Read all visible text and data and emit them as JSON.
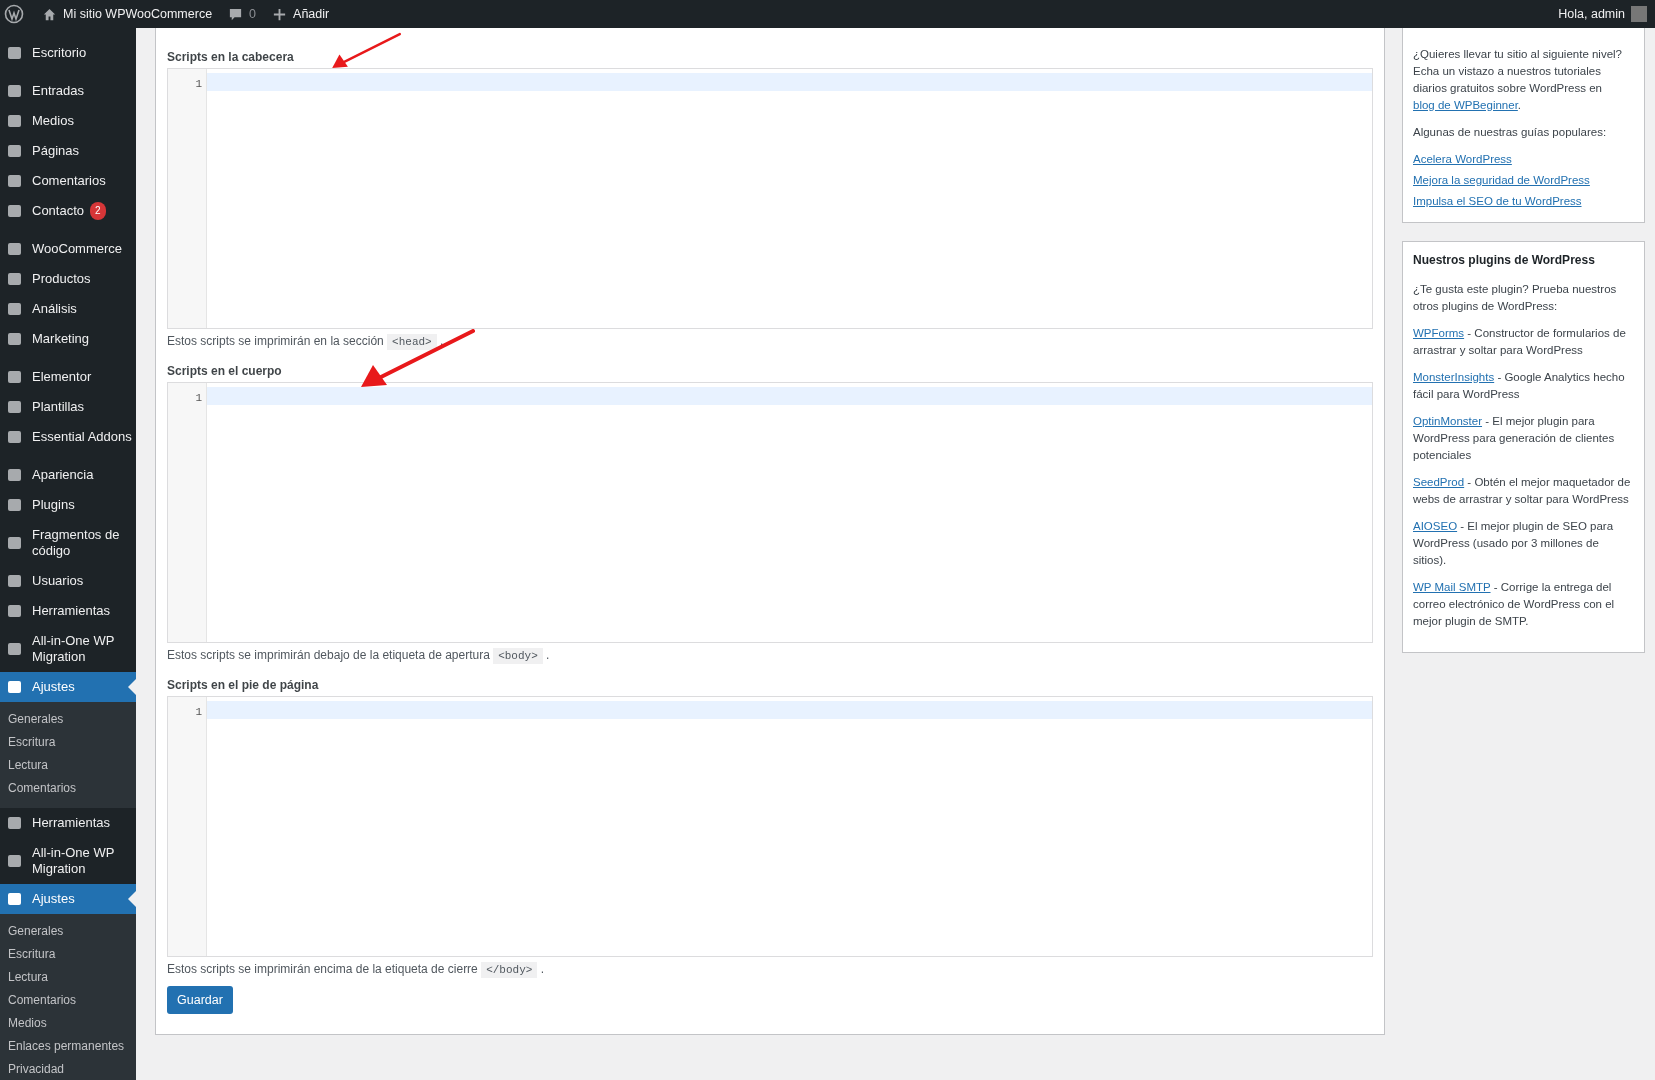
{
  "admin_bar": {
    "site": "Mi sitio WPWooCommerce",
    "comments": "0",
    "new": "Añadir",
    "greeting": "Hola, admin"
  },
  "sidebar": {
    "groups": [
      {
        "items": [
          {
            "label": "Escritorio",
            "selected": false
          }
        ]
      },
      {
        "items": [
          {
            "label": "Entradas",
            "selected": false
          },
          {
            "label": "Medios",
            "selected": false
          },
          {
            "label": "Páginas",
            "selected": false
          },
          {
            "label": "Comentarios",
            "selected": false
          },
          {
            "label": "Contacto",
            "badge": "2",
            "selected": false
          }
        ]
      },
      {
        "items": [
          {
            "label": "WooCommerce",
            "selected": false
          },
          {
            "label": "Productos",
            "selected": false
          },
          {
            "label": "Análisis",
            "selected": false
          },
          {
            "label": "Marketing",
            "selected": false
          }
        ]
      },
      {
        "items": [
          {
            "label": "Elementor",
            "selected": false
          },
          {
            "label": "Plantillas",
            "selected": false
          },
          {
            "label": "Essential Addons",
            "selected": false
          }
        ]
      },
      {
        "items": [
          {
            "label": "Apariencia",
            "selected": false
          },
          {
            "label": "Plugins",
            "selected": false
          },
          {
            "label": "Fragmentos de código",
            "selected": false
          },
          {
            "label": "Usuarios",
            "selected": false
          },
          {
            "label": "Herramientas",
            "selected": false
          },
          {
            "label": "All-in-One WP Migration",
            "selected": false
          },
          {
            "label": "Ajustes",
            "selected": true,
            "submenu": [
              {
                "label": "Generales",
                "selected": false
              },
              {
                "label": "Escritura",
                "selected": false
              },
              {
                "label": "Lectura",
                "selected": false
              },
              {
                "label": "Comentarios",
                "selected": false
              }
            ]
          }
        ]
      },
      {
        "items": [
          {
            "label": "Herramientas",
            "selected": false
          },
          {
            "label": "All-in-One WP Migration",
            "selected": false
          },
          {
            "label": "Ajustes",
            "selected": true,
            "submenu": [
              {
                "label": "Generales",
                "selected": false
              },
              {
                "label": "Escritura",
                "selected": false
              },
              {
                "label": "Lectura",
                "selected": false
              },
              {
                "label": "Comentarios",
                "selected": false
              },
              {
                "label": "Medios",
                "selected": false
              },
              {
                "label": "Enlaces permanentes",
                "selected": false
              },
              {
                "label": "Privacidad",
                "selected": false
              }
            ]
          }
        ]
      }
    ]
  },
  "sections": [
    {
      "label": "Scripts en la cabecera",
      "line_number": "1",
      "help_before": "Estos scripts se imprimirán en la sección",
      "code": "<head>",
      "help_after": ".",
      "arrow": true
    },
    {
      "label": "Scripts en el cuerpo",
      "line_number": "1",
      "help_before": "Estos scripts se imprimirán debajo de la etiqueta de apertura",
      "code": "<body>",
      "help_after": ".",
      "arrow": true
    },
    {
      "label": "Scripts en el pie de página",
      "line_number": "1",
      "help_before": "Estos scripts se imprimirán encima de la etiqueta de cierre",
      "code": "</body>",
      "help_after": ".",
      "arrow": false
    }
  ],
  "save_button": "Guardar",
  "promo_card": {
    "intro_before": "¿Quieres llevar tu sitio al siguiente nivel? Echa un vistazo a nuestros tutoriales diarios gratuitos sobre WordPress en ",
    "intro_link": "blog de WPBeginner",
    "intro_after": ".",
    "guides_heading": "Algunas de nuestras guías populares:",
    "guides": [
      "Acelera WordPress",
      "Mejora la seguridad de WordPress",
      "Impulsa el SEO de tu WordPress"
    ]
  },
  "plugins_card": {
    "title": "Nuestros plugins de WordPress",
    "intro": "¿Te gusta este plugin? Prueba nuestros otros plugins de WordPress:",
    "plugins": [
      {
        "name": "WPForms",
        "description": " - Constructor de formularios de arrastrar y soltar para WordPress"
      },
      {
        "name": "MonsterInsights",
        "description": " - Google Analytics hecho fácil para WordPress"
      },
      {
        "name": "OptinMonster",
        "description": " - El mejor plugin para WordPress para generación de clientes potenciales"
      },
      {
        "name": "SeedProd",
        "description": " - Obtén el mejor maquetador de webs de arrastrar y soltar para WordPress"
      },
      {
        "name": "AIOSEO",
        "description": " - El mejor plugin de SEO para WordPress (usado por 3 millones de sitios)."
      },
      {
        "name": "WP Mail SMTP",
        "description": " - Corrige la entrega del correo electrónico de WordPress con el mejor plugin de SMTP."
      }
    ]
  }
}
